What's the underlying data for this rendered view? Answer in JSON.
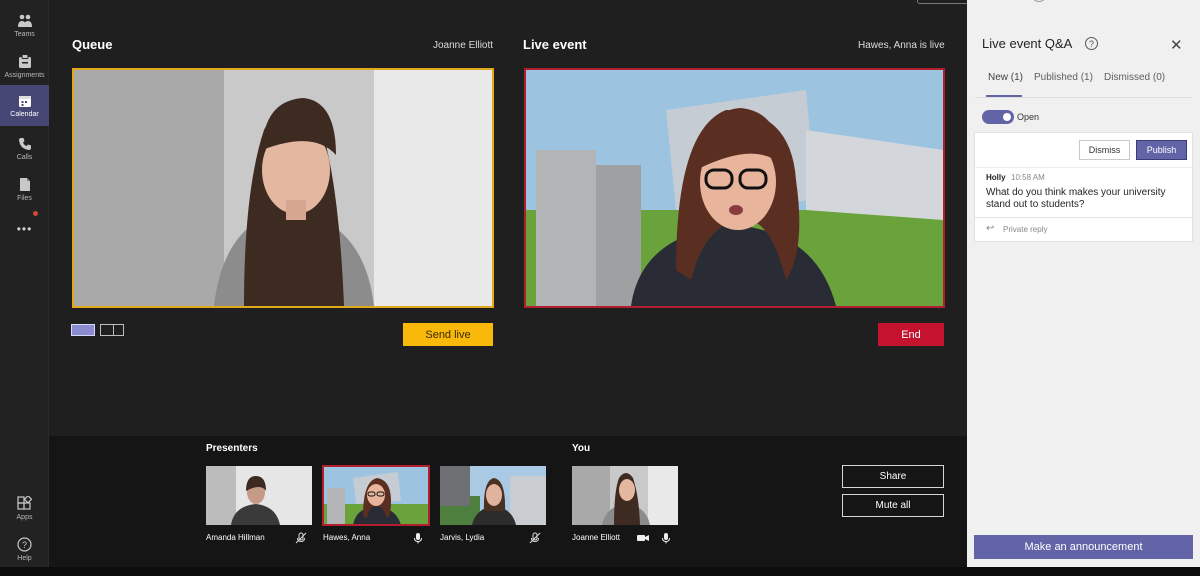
{
  "rail": {
    "items": [
      {
        "label": "Teams"
      },
      {
        "label": "Assignments"
      },
      {
        "label": "Calendar"
      },
      {
        "label": "Calls"
      },
      {
        "label": "Files"
      },
      {
        "label": "Apps"
      },
      {
        "label": "Help"
      }
    ],
    "more_label": "•••"
  },
  "queue": {
    "title": "Queue",
    "presenter": "Joanne Elliott",
    "send_live_label": "Send live"
  },
  "live": {
    "title": "Live event",
    "status": "Hawes, Anna is live",
    "end_label": "End"
  },
  "strip": {
    "presenters_label": "Presenters",
    "you_label": "You",
    "presenters": [
      {
        "name": "Amanda Hillman",
        "mic": "muted"
      },
      {
        "name": "Hawes, Anna",
        "mic": "on"
      },
      {
        "name": "Jarvis, Lydia",
        "mic": "muted"
      }
    ],
    "you": {
      "name": "Joanne Elliott"
    },
    "share_label": "Share",
    "mute_all_label": "Mute all"
  },
  "qa": {
    "title": "Live event Q&A",
    "tabs": [
      {
        "label": "New (1)",
        "active": true
      },
      {
        "label": "Published (1)",
        "active": false
      },
      {
        "label": "Dismissed (0)",
        "active": false
      }
    ],
    "open_label": "Open",
    "question": {
      "author": "Holly",
      "time": "10:58 AM",
      "text": "What do you think makes your university stand out to students?",
      "dismiss_label": "Dismiss",
      "publish_label": "Publish",
      "reply_label": "Private reply"
    },
    "announce_label": "Make an announcement"
  },
  "colors": {
    "accent": "#6264a7",
    "send_live": "#f8b90a",
    "end": "#c4122f",
    "queue_border": "#e0a91c",
    "live_border": "#b01e2f"
  }
}
